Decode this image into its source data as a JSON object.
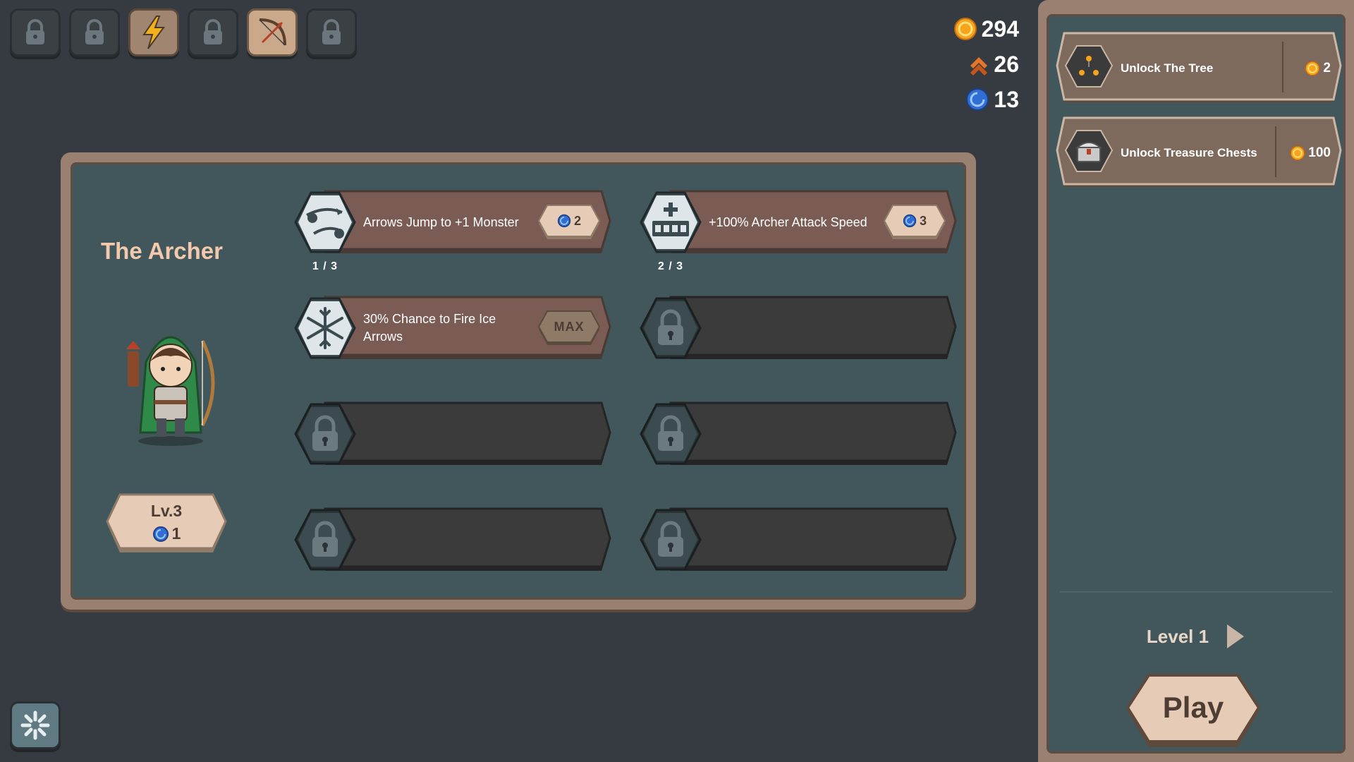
{
  "tabs": [
    {
      "icon": "lock-icon",
      "active": false
    },
    {
      "icon": "lock-icon",
      "active": false
    },
    {
      "icon": "lightning-icon",
      "active": false
    },
    {
      "icon": "lock-icon",
      "active": false
    },
    {
      "icon": "bow-icon",
      "active": true
    },
    {
      "icon": "lock-icon",
      "active": false
    }
  ],
  "currencies": {
    "coins": "294",
    "rank": "26",
    "gems": "13"
  },
  "hero": {
    "name": "The Archer",
    "level_label": "Lv.3",
    "level_cost": "1"
  },
  "skills": [
    {
      "label": "Arrows Jump to +1 Monster",
      "price": "2",
      "progress": "1 / 3",
      "icon": "arrow-jump-icon"
    },
    {
      "label": "+100% Archer Attack Speed",
      "price": "3",
      "progress": "2 / 3",
      "icon": "speed-icon"
    },
    {
      "label": "30% Chance to Fire Ice Arrows",
      "price": "MAX",
      "icon": "snowflake-icon"
    }
  ],
  "quests": [
    {
      "label": "Unlock The Tree",
      "cost": "2",
      "icon": "tree-icon"
    },
    {
      "label": "Unlock Treasure Chests",
      "cost": "100",
      "icon": "chest-icon"
    }
  ],
  "level_select": {
    "label": "Level 1"
  },
  "play_button": {
    "label": "Play"
  },
  "colors": {
    "background": "#353b40",
    "panel_frame": "#9a8070",
    "panel_fill": "#41575b",
    "skill_active": "#7a5c55",
    "skill_locked": "#3b3b3b",
    "hero_name": "#f3c9ad",
    "coin": "#f7a41d",
    "gem": "#2f6fd3"
  }
}
